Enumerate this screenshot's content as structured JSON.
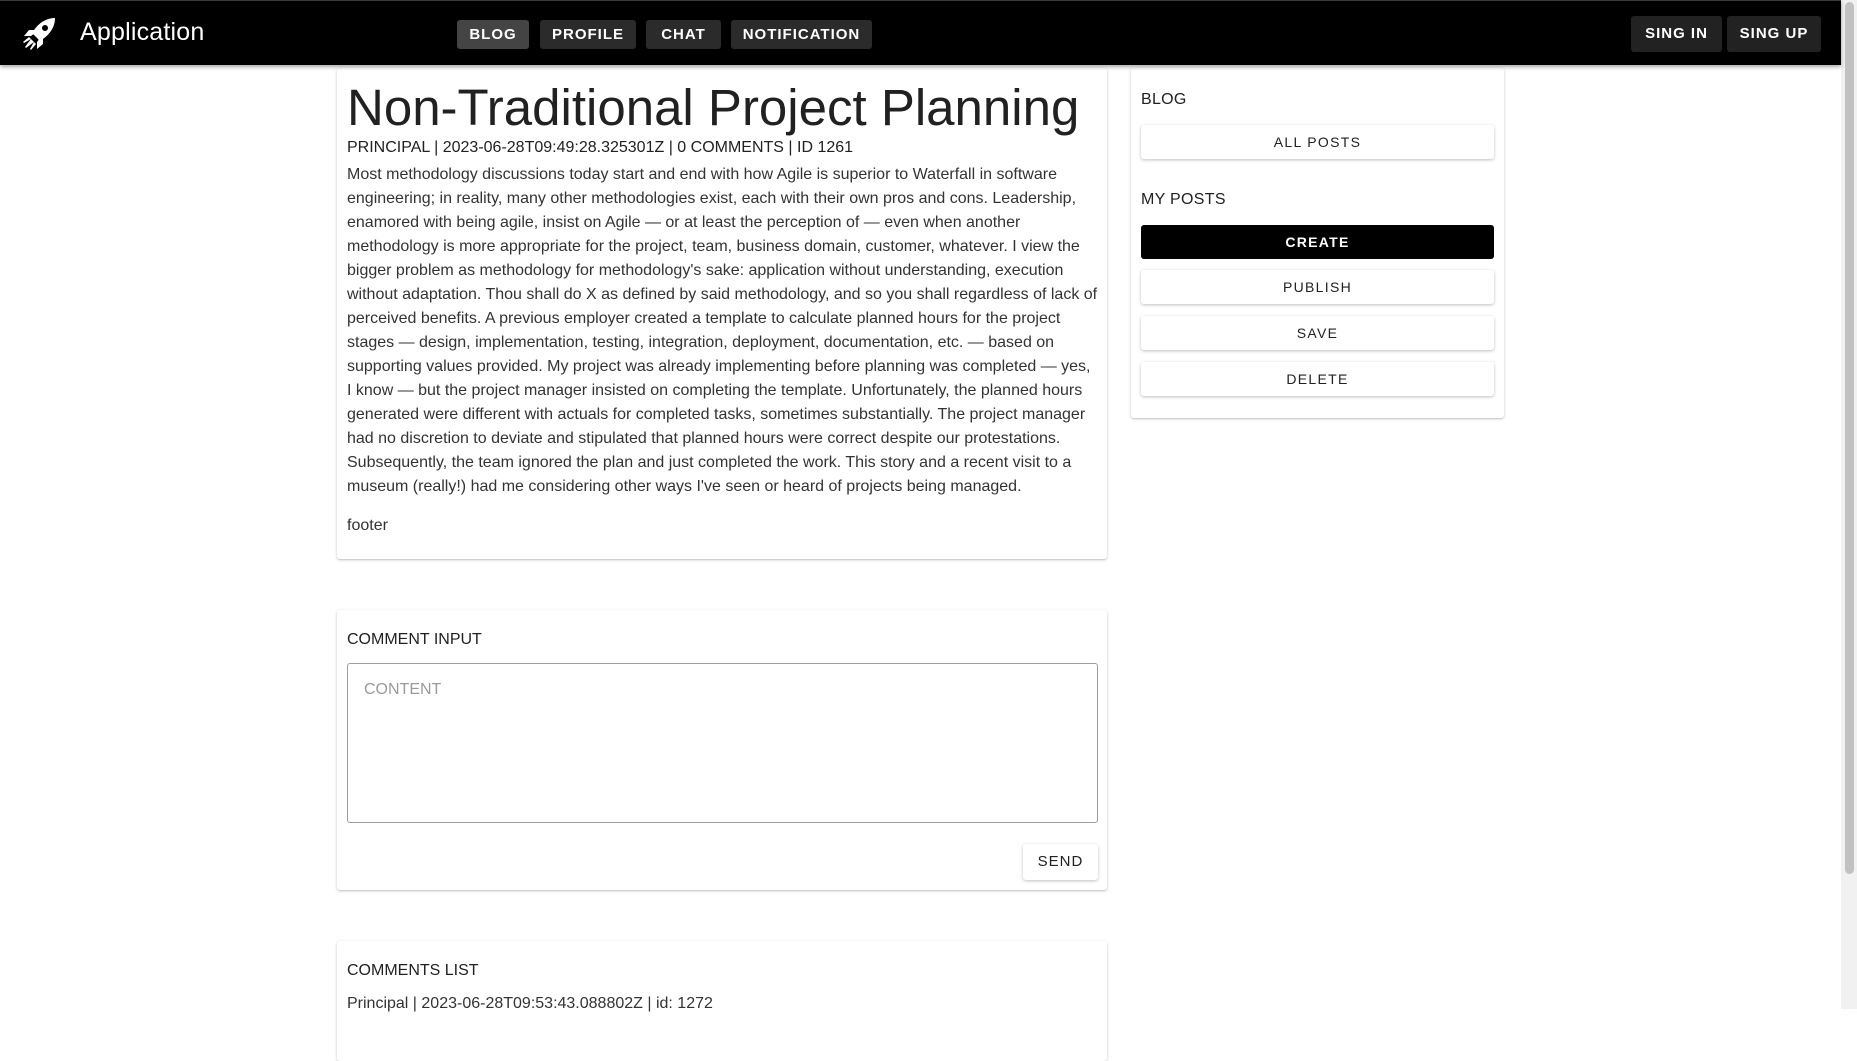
{
  "appbar": {
    "title": "Application",
    "logo_icon": "rocket-icon",
    "nav": [
      "BLOG",
      "PROFILE",
      "CHAT",
      "NOTIFICATION"
    ],
    "active_nav": "BLOG",
    "auth": [
      "SING IN",
      "SING UP"
    ]
  },
  "post": {
    "title": "Non-Traditional Project Planning",
    "meta": "PRINCIPAL | 2023-06-28T09:49:28.325301Z | 0 COMMENTS | ID 1261",
    "body": "Most methodology discussions today start and end with how Agile is superior to Waterfall in software engineering; in reality, many other methodologies exist, each with their own pros and cons. Leadership, enamored with being agile, insist on Agile — or at least the perception of — even when another methodology is more appropriate for the project, team, business domain, customer, whatever. I view the bigger problem as methodology for methodology's sake: application without understanding, execution without adaptation. Thou shall do X as defined by said methodology, and so you shall regardless of lack of perceived benefits. A previous employer created a template to calculate planned hours for the project stages — design, implementation, testing, integration, deployment, documentation, etc. — based on supporting values provided. My project was already implementing before planning was completed — yes, I know — but the project manager insisted on completing the template. Unfortunately, the planned hours generated were different with actuals for completed tasks, sometimes substantially. The project manager had no discretion to deviate and stipulated that planned hours were correct despite our protestations. Subsequently, the team ignored the plan and just completed the work. This story and a recent visit to a museum (really!) had me considering other ways I've seen or heard of projects being managed.",
    "footer": "footer"
  },
  "comment_input": {
    "label": "COMMENT INPUT",
    "placeholder": "CONTENT",
    "send_label": "SEND"
  },
  "comments_list": {
    "label": "COMMENTS LIST",
    "items": [
      "Principal | 2023-06-28T09:53:43.088802Z | id: 1272"
    ]
  },
  "sidebar": {
    "blog_label": "BLOG",
    "all_posts": "ALL POSTS",
    "my_posts_label": "MY POSTS",
    "create": "CREATE",
    "publish": "PUBLISH",
    "save": "SAVE",
    "delete": "DELETE"
  }
}
